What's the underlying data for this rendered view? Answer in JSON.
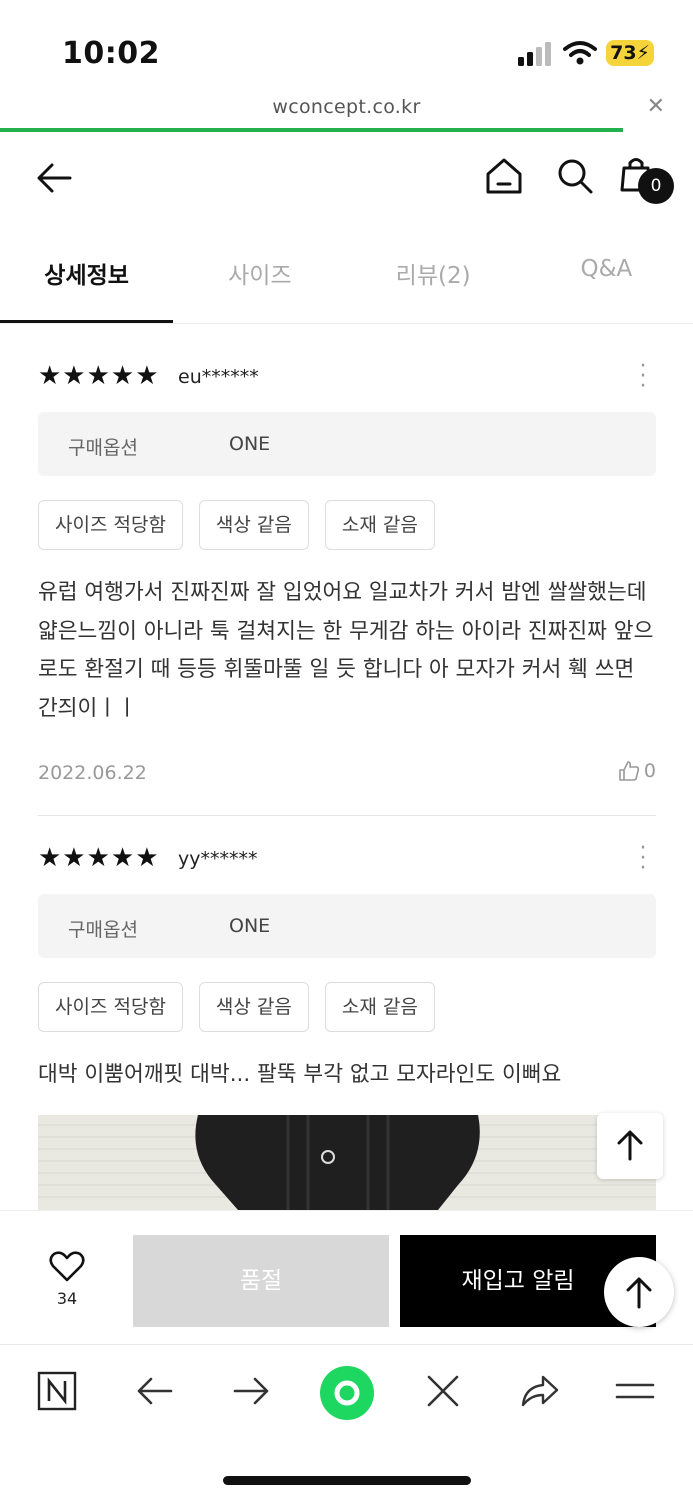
{
  "status_bar": {
    "time": "10:02",
    "battery": "73"
  },
  "browser": {
    "url": "wconcept.co.kr"
  },
  "header": {
    "cart_count": "0"
  },
  "tabs": [
    {
      "label": "상세정보",
      "active": true
    },
    {
      "label": "사이즈",
      "active": false
    },
    {
      "label": "리뷰(2)",
      "active": false
    },
    {
      "label": "Q&A",
      "active": false
    }
  ],
  "reviews": [
    {
      "stars": "★★★★★",
      "user": "eu******",
      "option_label": "구매옵션",
      "option_value": "ONE",
      "tags": [
        "사이즈 적당함",
        "색상 같음",
        "소재 같음"
      ],
      "text": "유럽 여행가서 진짜진짜 잘 입었어요 일교차가 커서 밤엔 쌀쌀했는데 얇은느낌이 아니라 툭 걸쳐지는 한 무게감 하는 아이라 진짜진짜 앞으로도 환절기 때 등등 휘뚤마뚤 일 듯 합니다 아 모자가 커서 훽 쓰면 간즤이ㅣㅣ",
      "date": "2022.06.22",
      "likes": "0"
    },
    {
      "stars": "★★★★★",
      "user": "yy******",
      "option_label": "구매옵션",
      "option_value": "ONE",
      "tags": [
        "사이즈 적당함",
        "색상 같음",
        "소재 같음"
      ],
      "text": "대박 이뿜어깨핏 대박... 팔뚝 부각 없고 모자라인도 이뻐요"
    }
  ],
  "actions": {
    "wish_count": "34",
    "soldout_label": "품절",
    "notify_label": "재입고 알림"
  },
  "icons": {
    "back": "arrow-left-icon",
    "home": "home-icon",
    "search": "search-icon",
    "cart": "shopping-bag-icon"
  },
  "colors": {
    "progress": "#22b14c",
    "battery": "#f5d33a",
    "naver_green": "#1ed760"
  }
}
